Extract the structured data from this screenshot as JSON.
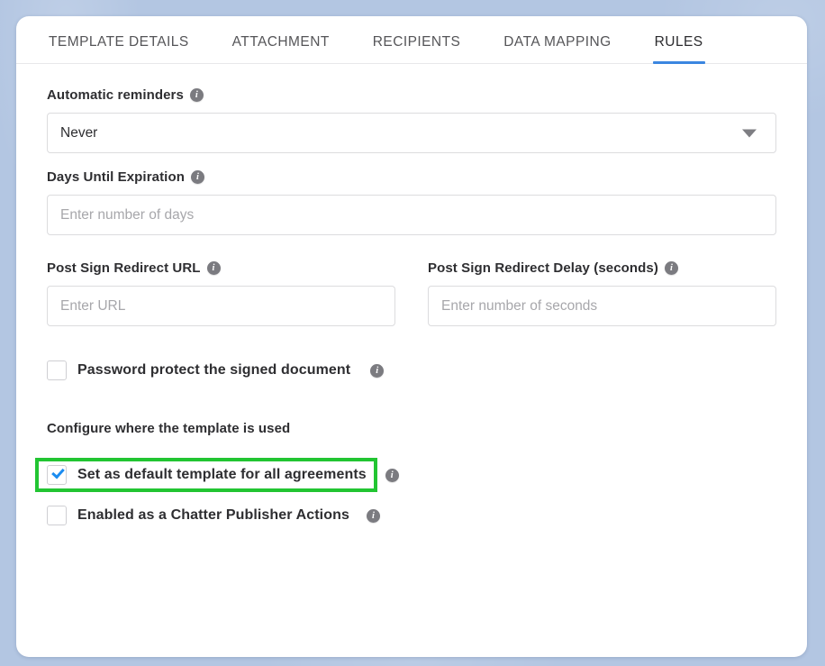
{
  "theme": {
    "page_background": "#b3c6e2",
    "card_background": "#ffffff",
    "accent_tab": "#3b86e0",
    "checkbox_check": "#1b8cf0",
    "highlight_border": "#22c532",
    "info_icon": "#7b7b80"
  },
  "tabs": [
    {
      "label": "TEMPLATE DETAILS",
      "active": false,
      "name": "tab-template-details"
    },
    {
      "label": "ATTACHMENT",
      "active": false,
      "name": "tab-attachment"
    },
    {
      "label": "RECIPIENTS",
      "active": false,
      "name": "tab-recipients"
    },
    {
      "label": "DATA MAPPING",
      "active": false,
      "name": "tab-data-mapping"
    },
    {
      "label": "RULES",
      "active": true,
      "name": "tab-rules"
    }
  ],
  "form": {
    "automatic_reminders": {
      "label": "Automatic reminders",
      "info_icon": "info-icon",
      "value": "Never",
      "chevron_icon": "chevron-down-icon"
    },
    "days_until_expiration": {
      "label": "Days Until Expiration",
      "info_icon": "info-icon",
      "value": "",
      "placeholder": "Enter number of days"
    },
    "post_sign_redirect_url": {
      "label": "Post Sign Redirect URL",
      "info_icon": "info-icon",
      "value": "",
      "placeholder": "Enter URL"
    },
    "post_sign_redirect_delay": {
      "label": "Post Sign Redirect Delay (seconds)",
      "info_icon": "info-icon",
      "value": "",
      "placeholder": "Enter number of seconds"
    },
    "password_protect": {
      "label": "Password protect the signed document",
      "checked": false,
      "info_icon": "info-icon"
    },
    "configure_section": {
      "title": "Configure where the template is used",
      "options": [
        {
          "label": "Set as default template for all agreements",
          "checked": true,
          "highlighted": true,
          "info_icon": "info-icon"
        },
        {
          "label": "Enabled as a Chatter Publisher Actions",
          "checked": false,
          "highlighted": false,
          "info_icon": "info-icon"
        }
      ]
    }
  },
  "icons": {
    "info": "i"
  }
}
